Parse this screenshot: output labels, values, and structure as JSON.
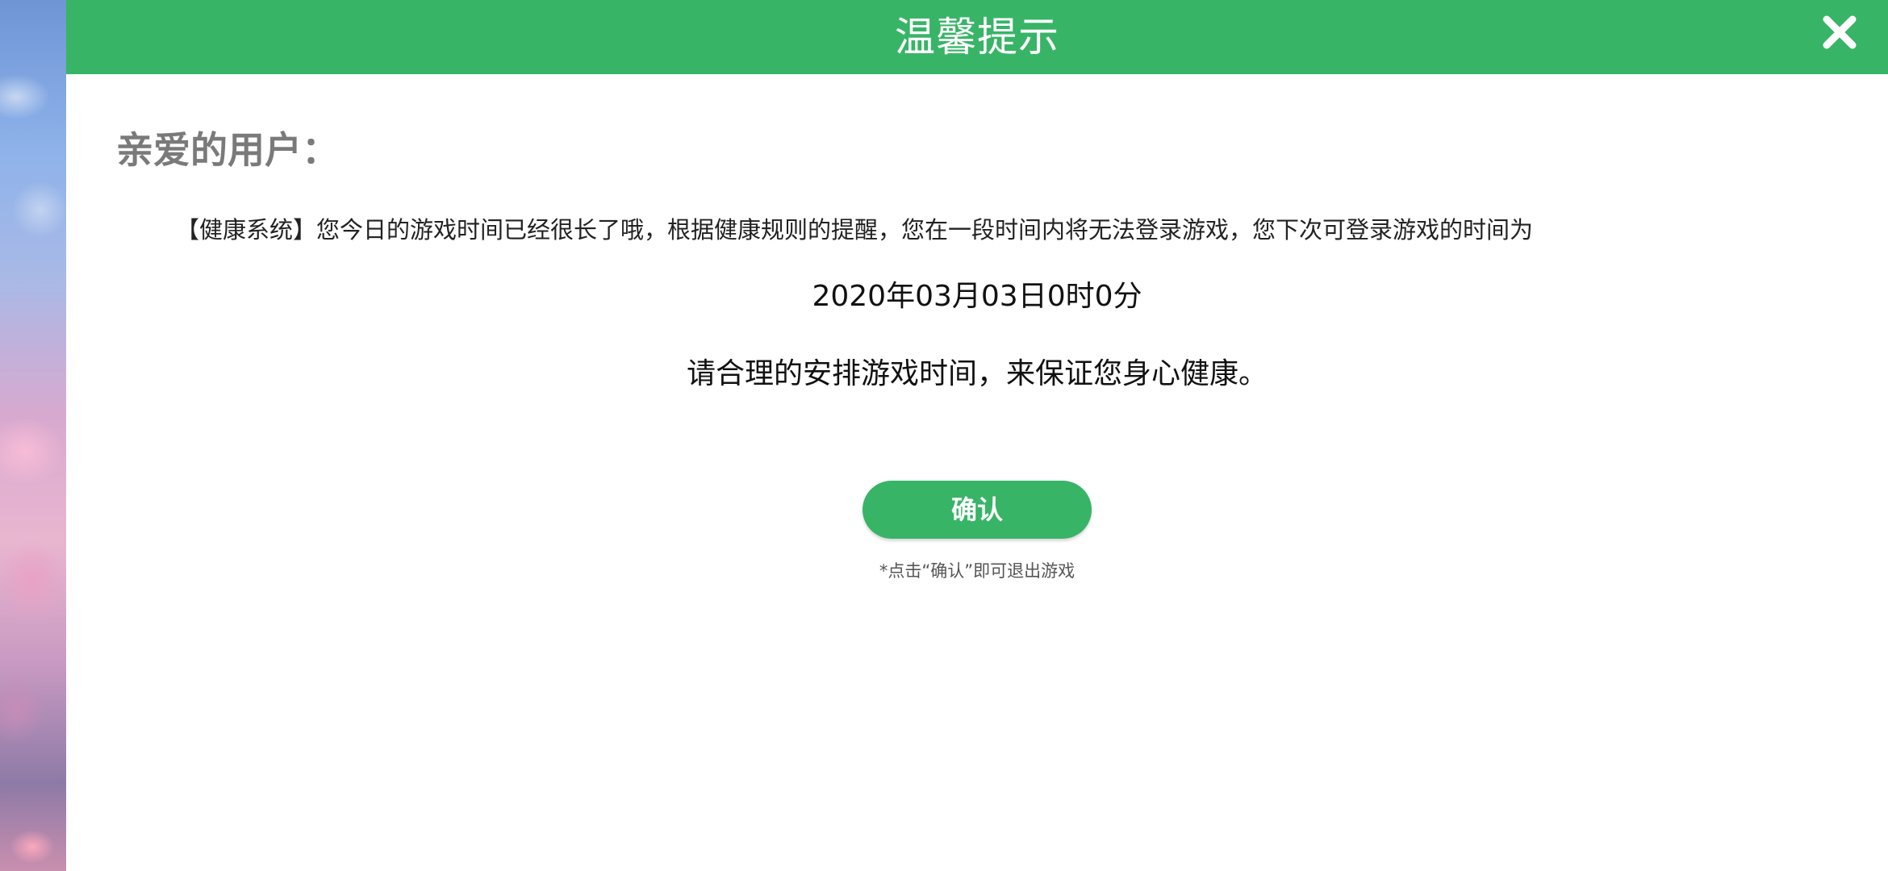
{
  "dialog": {
    "title": "温馨提示",
    "greeting": "亲爱的用户：",
    "message": "【健康系统】您今日的游戏时间已经很长了哦，根据健康规则的提醒，您在一段时间内将无法登录游戏，您下次可登录游戏的时间为",
    "next_login_time": "2020年03月03日0时0分",
    "advice": "请合理的安排游戏时间，来保证您身心健康。",
    "confirm_label": "确认",
    "hint": "*点击“确认”即可退出游戏"
  },
  "icons": {
    "close": "close-icon"
  },
  "colors": {
    "accent": "#38b467",
    "greeting_text": "#7a7a7a",
    "body_text": "#111111"
  }
}
